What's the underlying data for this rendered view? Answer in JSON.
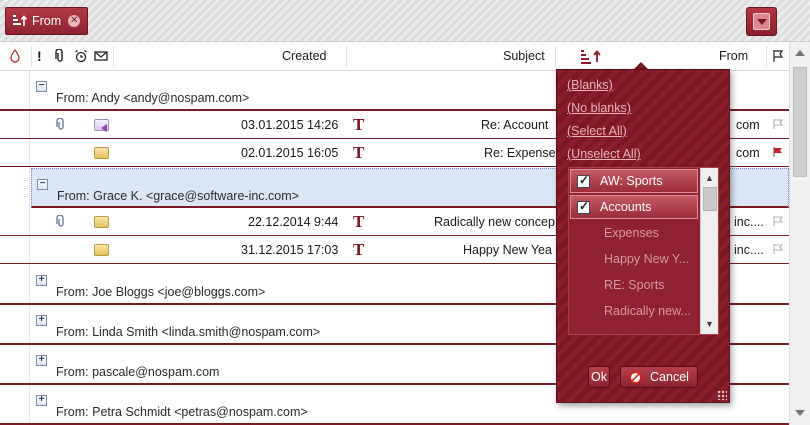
{
  "group_panel": {
    "chip_label": "From",
    "dropdown_button": "filter-dropdown"
  },
  "header": {
    "created": "Created",
    "subject": "Subject",
    "from": "From"
  },
  "groups": [
    {
      "label": "From: Andy <andy@nospam.com>",
      "expanded": true,
      "rows": [
        {
          "created": "03.01.2015 14:26",
          "subject": "Re: Account",
          "from": "com"
        },
        {
          "created": "02.01.2015 16:05",
          "subject": "Re: Expense",
          "from": "com"
        }
      ]
    },
    {
      "label": "From: Grace K. <grace@software-inc.com>",
      "expanded": true,
      "rows": [
        {
          "created": "22.12.2014 9:44",
          "subject": "Radically new concep",
          "from": "inc...."
        },
        {
          "created": "31.12.2015 17:03",
          "subject": "Happy New Yea",
          "from": "inc...."
        }
      ]
    },
    {
      "label": "From: Joe Bloggs <joe@bloggs.com>",
      "expanded": false
    },
    {
      "label": "From: Linda Smith <linda.smith@nospam.com>",
      "expanded": false
    },
    {
      "label": "From: pascale@nospam.com",
      "expanded": false
    },
    {
      "label": "From: Petra Schmidt <petras@nospam.com>",
      "expanded": false
    }
  ],
  "filter_popup": {
    "links": [
      "(Blanks)",
      "(No blanks)",
      "(Select All)",
      "(Unselect All)"
    ],
    "items": [
      {
        "label": "AW: Sports",
        "checked": true
      },
      {
        "label": "Accounts",
        "checked": true
      },
      {
        "label": "Expenses",
        "checked": false
      },
      {
        "label": "Happy New Y...",
        "checked": false
      },
      {
        "label": "RE: Sports",
        "checked": false
      },
      {
        "label": "Radically new...",
        "checked": false
      }
    ],
    "ok_label": "Ok",
    "cancel_label": "Cancel"
  },
  "colors": {
    "accent": "#8a1e2b",
    "selected_row": "#dbe6f6",
    "group_line": "#7a1a24"
  }
}
